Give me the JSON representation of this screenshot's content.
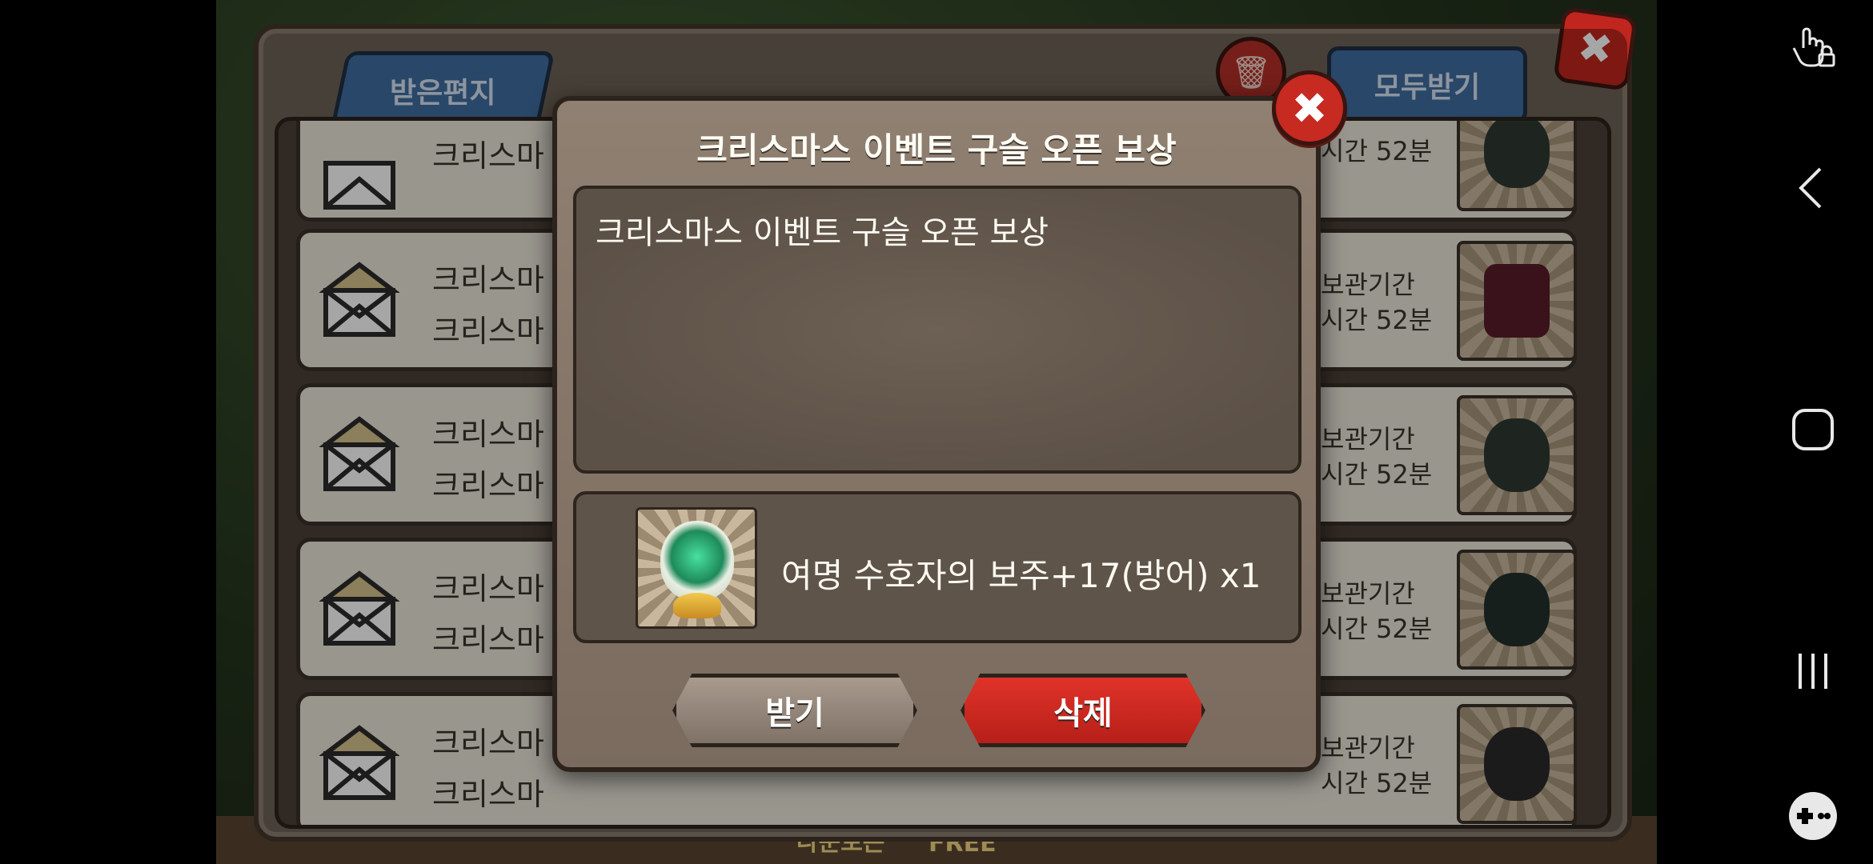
{
  "background": {
    "labels": [
      "나눈토는",
      "FREE"
    ]
  },
  "mailbox": {
    "tab_label": "받은편지",
    "receive_all_label": "모두받기",
    "rows": [
      {
        "line1": "크리스마",
        "line2": "",
        "right1": "",
        "right2": "시간 52분"
      },
      {
        "line1": "크리스마",
        "line2": "크리스마",
        "right1": "보관기간",
        "right2": "시간 52분"
      },
      {
        "line1": "크리스마",
        "line2": "크리스마",
        "right1": "보관기간",
        "right2": "시간 52분"
      },
      {
        "line1": "크리스마",
        "line2": "크리스마",
        "right1": "보관기간",
        "right2": "시간 52분"
      },
      {
        "line1": "크리스마",
        "line2": "크리스마",
        "right1": "보관기간",
        "right2": "시간 52분"
      }
    ]
  },
  "modal": {
    "title": "크리스마스 이벤트 구슬 오픈 보상",
    "body": "크리스마스 이벤트 구슬 오픈 보상",
    "reward_text": "여명 수호자의 보주+17(방어) x1",
    "receive_label": "받기",
    "delete_label": "삭제",
    "colors": {
      "accent_red": "#c62a21",
      "tab_blue": "#3f6ea0"
    }
  },
  "navbar": {
    "icons": [
      "touch-lock-icon",
      "back-icon",
      "home-icon",
      "recents-icon",
      "game-launcher-icon"
    ]
  }
}
